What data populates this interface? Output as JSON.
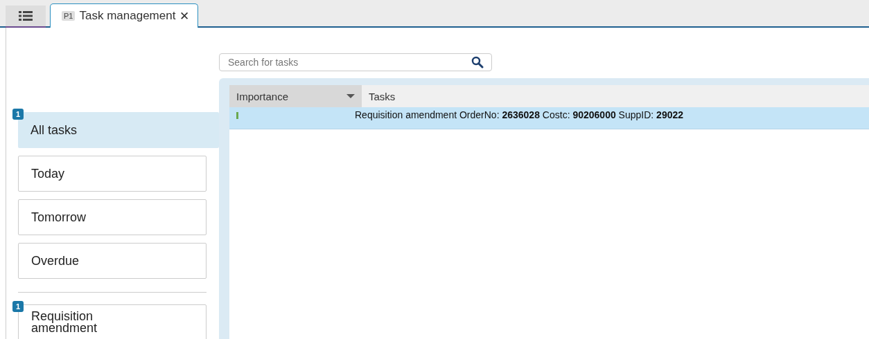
{
  "tabs": [
    {
      "kind": "menu",
      "selected": false
    },
    {
      "kind": "page",
      "badge": "P1",
      "label": "Task management",
      "close": "✕",
      "selected": true
    }
  ],
  "search": {
    "placeholder": "Search for tasks"
  },
  "filters": [
    {
      "kind": "period",
      "label": "All tasks",
      "count": "1",
      "selected": true
    },
    {
      "kind": "period",
      "label": "Today",
      "selected": false
    },
    {
      "kind": "period",
      "label": "Tomorrow",
      "selected": false
    },
    {
      "kind": "period",
      "label": "Overdue",
      "selected": false
    },
    {
      "kind": "category",
      "label": "Requisition amendment",
      "count": "1",
      "selected": false
    }
  ],
  "table": {
    "columns": [
      {
        "label": "Importance",
        "sortable": true
      },
      {
        "label": "Tasks",
        "sortable": false
      }
    ],
    "rows": [
      {
        "selected": true,
        "color": "#6aa84f",
        "task": "Requisition amendment OrderNo: **2636028** Costc: **90206000** SuppID: **29022**"
      }
    ]
  }
}
